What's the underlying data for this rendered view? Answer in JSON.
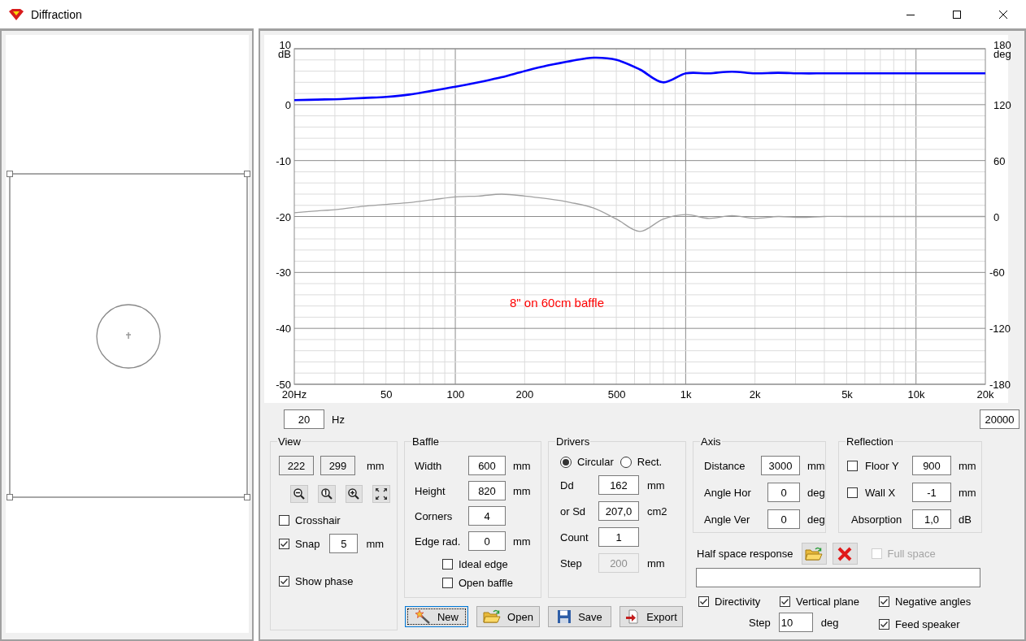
{
  "window": {
    "title": "Diffraction"
  },
  "chart": {
    "left_unit": "dB",
    "right_unit": "deg",
    "chart_data": {
      "type": "line",
      "categories": [
        "20Hz",
        null,
        null,
        null,
        "50",
        null,
        null,
        "100",
        null,
        null,
        "200",
        null,
        null,
        null,
        "500",
        null,
        null,
        "1k",
        null,
        null,
        "2k",
        null,
        null,
        null,
        "5k",
        null,
        null,
        "10k",
        null,
        null,
        "20k"
      ],
      "series": [
        {
          "color": "#0000ff",
          "values": [
            0.8,
            0.9,
            1.0,
            1.2,
            1.4,
            1.8,
            2.5,
            3.2,
            4.0,
            4.9,
            6.0,
            7.0,
            7.8,
            8.4,
            8.0,
            6.3,
            4.0,
            5.6,
            5.6,
            5.9,
            5.6,
            5.7,
            5.6,
            5.6,
            5.6,
            5.6,
            5.6,
            5.6,
            5.6,
            5.6,
            5.6
          ]
        },
        {
          "color": "#a0a0a0",
          "axis": "y2",
          "values": [
            4,
            6,
            8,
            11,
            13,
            15,
            18,
            21,
            22,
            24,
            22,
            19,
            15,
            9,
            -3,
            -16,
            -3,
            2,
            -2,
            1,
            -2,
            0,
            -1,
            0,
            0,
            0,
            0,
            0,
            0,
            0,
            0
          ]
        }
      ],
      "ylim": [
        -50,
        10
      ],
      "y2lim": [
        -180,
        180
      ],
      "grid": true,
      "yticks": [
        10,
        0,
        -10,
        -20,
        -30,
        -40,
        -50
      ],
      "y2ticks": [
        180,
        120,
        60,
        0,
        -60,
        -120,
        -180
      ],
      "annotations": [
        "8\" on 60cm baffle"
      ]
    }
  },
  "freq_min": {
    "value": "20",
    "unit": "Hz"
  },
  "freq_max": {
    "value": "20000"
  },
  "view": {
    "title": "View",
    "size_fields": [
      {
        "value": "222",
        "read_only": true
      },
      {
        "value": "299",
        "read_only": true
      }
    ],
    "unit": "mm",
    "zoom_buttons": [
      {
        "kind": "zoom-out"
      },
      {
        "kind": "zoom-reset"
      },
      {
        "kind": "zoom-in"
      },
      {
        "kind": "fit"
      }
    ],
    "crosshair": {
      "label": "Crosshair",
      "checked": false
    },
    "snap": {
      "label": "Snap",
      "checked": true,
      "value": "5",
      "unit": "mm"
    },
    "show_phase": {
      "label": "Show phase",
      "checked": true
    }
  },
  "baffle": {
    "title": "Baffle",
    "fields": [
      {
        "label": "Width",
        "value": "600",
        "unit": "mm"
      },
      {
        "label": "Height",
        "value": "820",
        "unit": "mm"
      },
      {
        "label": "Corners",
        "value": "4"
      },
      {
        "label": "Edge rad.",
        "value": "0",
        "unit": "mm"
      }
    ],
    "checks": [
      {
        "label": "Ideal edge",
        "checked": false
      },
      {
        "label": "Open baffle",
        "checked": false
      }
    ]
  },
  "drivers": {
    "title": "Drivers",
    "shapes": [
      {
        "label": "Circular",
        "selected": true
      },
      {
        "label": "Rect.",
        "selected": false
      }
    ],
    "fields": [
      {
        "label": "Dd",
        "value": "162",
        "unit": "mm",
        "disabled": false
      },
      {
        "label": "or Sd",
        "value": "207,0",
        "unit": "cm2",
        "disabled": false
      },
      {
        "label": "Count",
        "value": "1",
        "disabled": false
      },
      {
        "label": "Step",
        "value": "200",
        "unit": "mm",
        "disabled": true
      }
    ]
  },
  "buttons": [
    {
      "kind": "new",
      "label": "New",
      "focused": true
    },
    {
      "kind": "open",
      "label": "Open",
      "focused": false
    },
    {
      "kind": "save",
      "label": "Save",
      "focused": false
    },
    {
      "kind": "export",
      "label": "Export",
      "focused": false
    }
  ],
  "axis": {
    "title": "Axis",
    "fields": [
      {
        "label": "Distance",
        "value": "3000",
        "unit": "mm"
      },
      {
        "label": "Angle Hor",
        "value": "0",
        "unit": "deg"
      },
      {
        "label": "Angle Ver",
        "value": "0",
        "unit": "deg"
      }
    ]
  },
  "reflection": {
    "title": "Reflection",
    "fields": [
      {
        "kind": "check",
        "label": "Floor Y",
        "checked": false,
        "value": "900",
        "unit": "mm"
      },
      {
        "kind": "check",
        "label": "Wall  X",
        "checked": false,
        "value": "-1",
        "unit": "mm"
      },
      {
        "kind": "plain",
        "label": "Absorption",
        "value": "1,0",
        "unit": "dB"
      }
    ]
  },
  "half_space": {
    "label": "Half space response",
    "full_space": {
      "label": "Full space",
      "checked": false,
      "disabled": true
    }
  },
  "options": [
    {
      "label": "Directivity",
      "checked": true
    },
    {
      "label": "Vertical plane",
      "checked": true
    },
    {
      "label": "Negative angles",
      "checked": true
    },
    {
      "label": "Feed speaker",
      "checked": true
    }
  ],
  "step": {
    "label": "Step",
    "value": "10",
    "unit": "deg"
  }
}
